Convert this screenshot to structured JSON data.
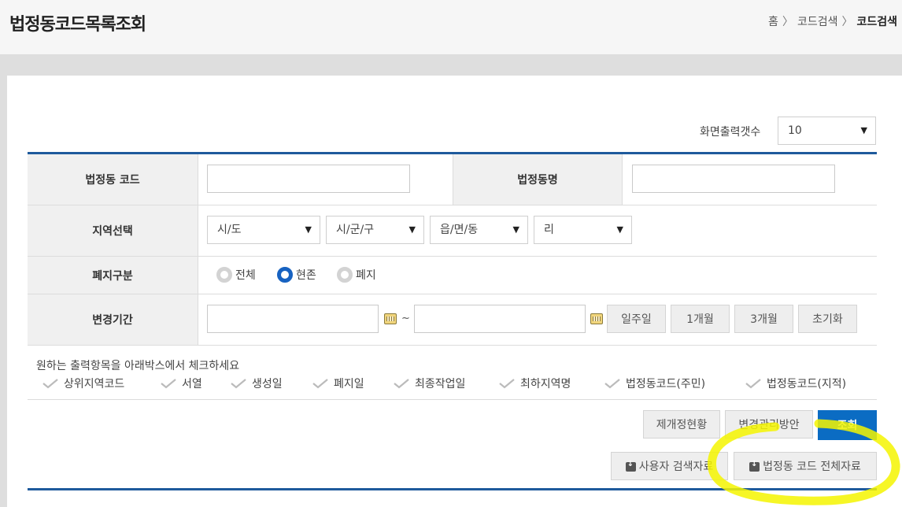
{
  "header": {
    "title": "법정동코드목록조회",
    "breadcrumb": [
      "홈",
      "코드검색",
      "코드검색"
    ],
    "breadcrumb_sep": "〉"
  },
  "display_count": {
    "label": "화면출력갯수",
    "value": "10"
  },
  "form": {
    "code_label": "법정동 코드",
    "name_label": "법정동명",
    "region_label": "지역선택",
    "region_selects": [
      "시/도",
      "시/군/구",
      "읍/면/동",
      "리"
    ],
    "status_label": "폐지구분",
    "status_options": [
      "전체",
      "현존",
      "폐지"
    ],
    "status_selected": "현존",
    "period_label": "변경기간",
    "period_tilde": "~",
    "period_buttons": [
      "일주일",
      "1개월",
      "3개월",
      "초기화"
    ]
  },
  "output_options": {
    "title": "원하는 출력항목을 아래박스에서 체크하세요",
    "items": [
      "상위지역코드",
      "서열",
      "생성일",
      "폐지일",
      "최종작업일",
      "최하지역명",
      "법정동코드(주민)",
      "법정동코드(지적)"
    ]
  },
  "actions": {
    "status_btn": "제개정현황",
    "plan_btn": "변경관리방안",
    "search_btn": "조회",
    "user_data_btn": "사용자 검색자료",
    "all_data_btn": "법정동 코드 전체자료"
  },
  "colors": {
    "accent": "#0b6cc3",
    "line": "#1e5a9c",
    "highlight": "#f4f400"
  }
}
